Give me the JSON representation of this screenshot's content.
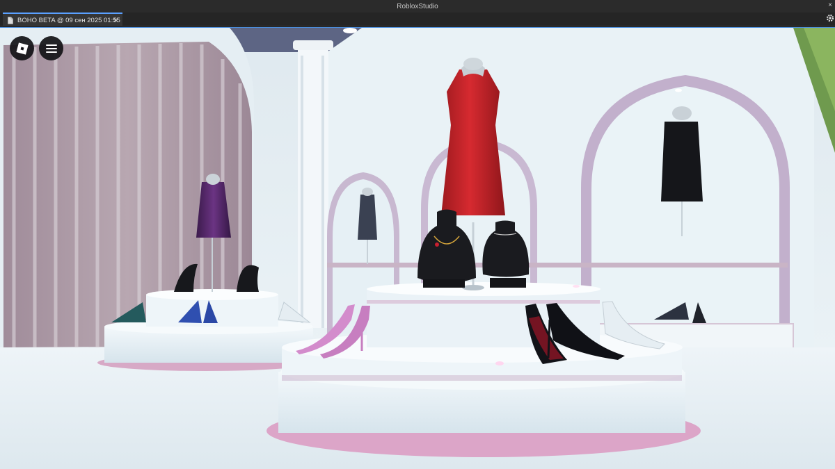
{
  "window": {
    "title": "RobloxStudio",
    "close_glyph": "×"
  },
  "tabs": [
    {
      "label": "BOHO BETA @ 09 сен 2025 01:55",
      "icon": "document-icon",
      "close_glyph": "×"
    }
  ],
  "toolbar": {
    "settings_icon": "gear-icon"
  },
  "viewport": {
    "buttons": [
      {
        "name": "roblox-logo-button",
        "icon": "roblox-logo-icon"
      },
      {
        "name": "menu-button",
        "icon": "hamburger-icon"
      }
    ]
  },
  "colors": {
    "titlebar": "#2b2b2b",
    "tabbar": "#252525",
    "accent": "#5aa0ff",
    "wall": "#e4eef3",
    "red_dress": "#c8232a"
  }
}
